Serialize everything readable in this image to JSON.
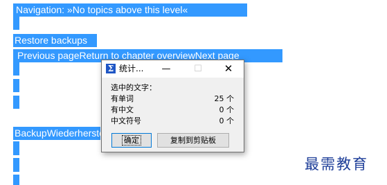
{
  "document": {
    "navigation_line": "Navigation:  »No topics above this level«",
    "heading_restore": "Restore backups",
    "nav_links": "Previous pageReturn to chapter overviewNext page",
    "heading_wiederherstellung": "BackupWiederherstellung"
  },
  "dialog": {
    "title": "统计...",
    "icon_glyph": "Σ",
    "minimize_glyph": "—",
    "maximize_glyph": "☐",
    "close_glyph": "✕",
    "selected_text_label": "选中的文字：",
    "stats": [
      {
        "label": "有单词",
        "count": "25 个"
      },
      {
        "label": "有中文",
        "count": "0 个"
      },
      {
        "label": "中文符号",
        "count": "0 个"
      }
    ],
    "ok_button": "确定",
    "copy_button": "复制到剪贴板"
  },
  "watermark": "最需教育",
  "colors": {
    "selection": "#3399ff",
    "title_icon": "#1f56c5",
    "watermark": "#1f3f99"
  }
}
